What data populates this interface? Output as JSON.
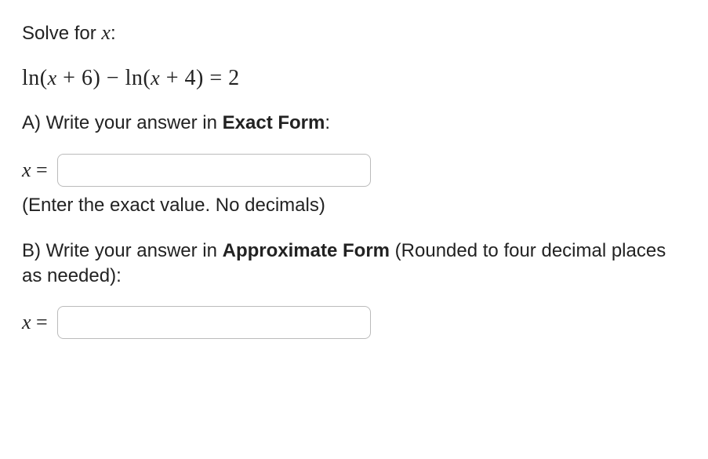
{
  "prompt": {
    "prefix": "Solve for ",
    "var": "x",
    "suffix": ":"
  },
  "equation": "ln(x + 6) − ln(x + 4) = 2",
  "partA": {
    "label_pre": "A) Write your answer in ",
    "label_bold": "Exact Form",
    "label_post": ":",
    "x_equals": "x =",
    "value": "",
    "hint": "(Enter the exact value. No decimals)"
  },
  "partB": {
    "label_pre": "B) Write your answer in ",
    "label_bold": "Approximate Form",
    "label_post": " (Rounded to four decimal places as needed):",
    "x_equals": "x =",
    "value": ""
  }
}
